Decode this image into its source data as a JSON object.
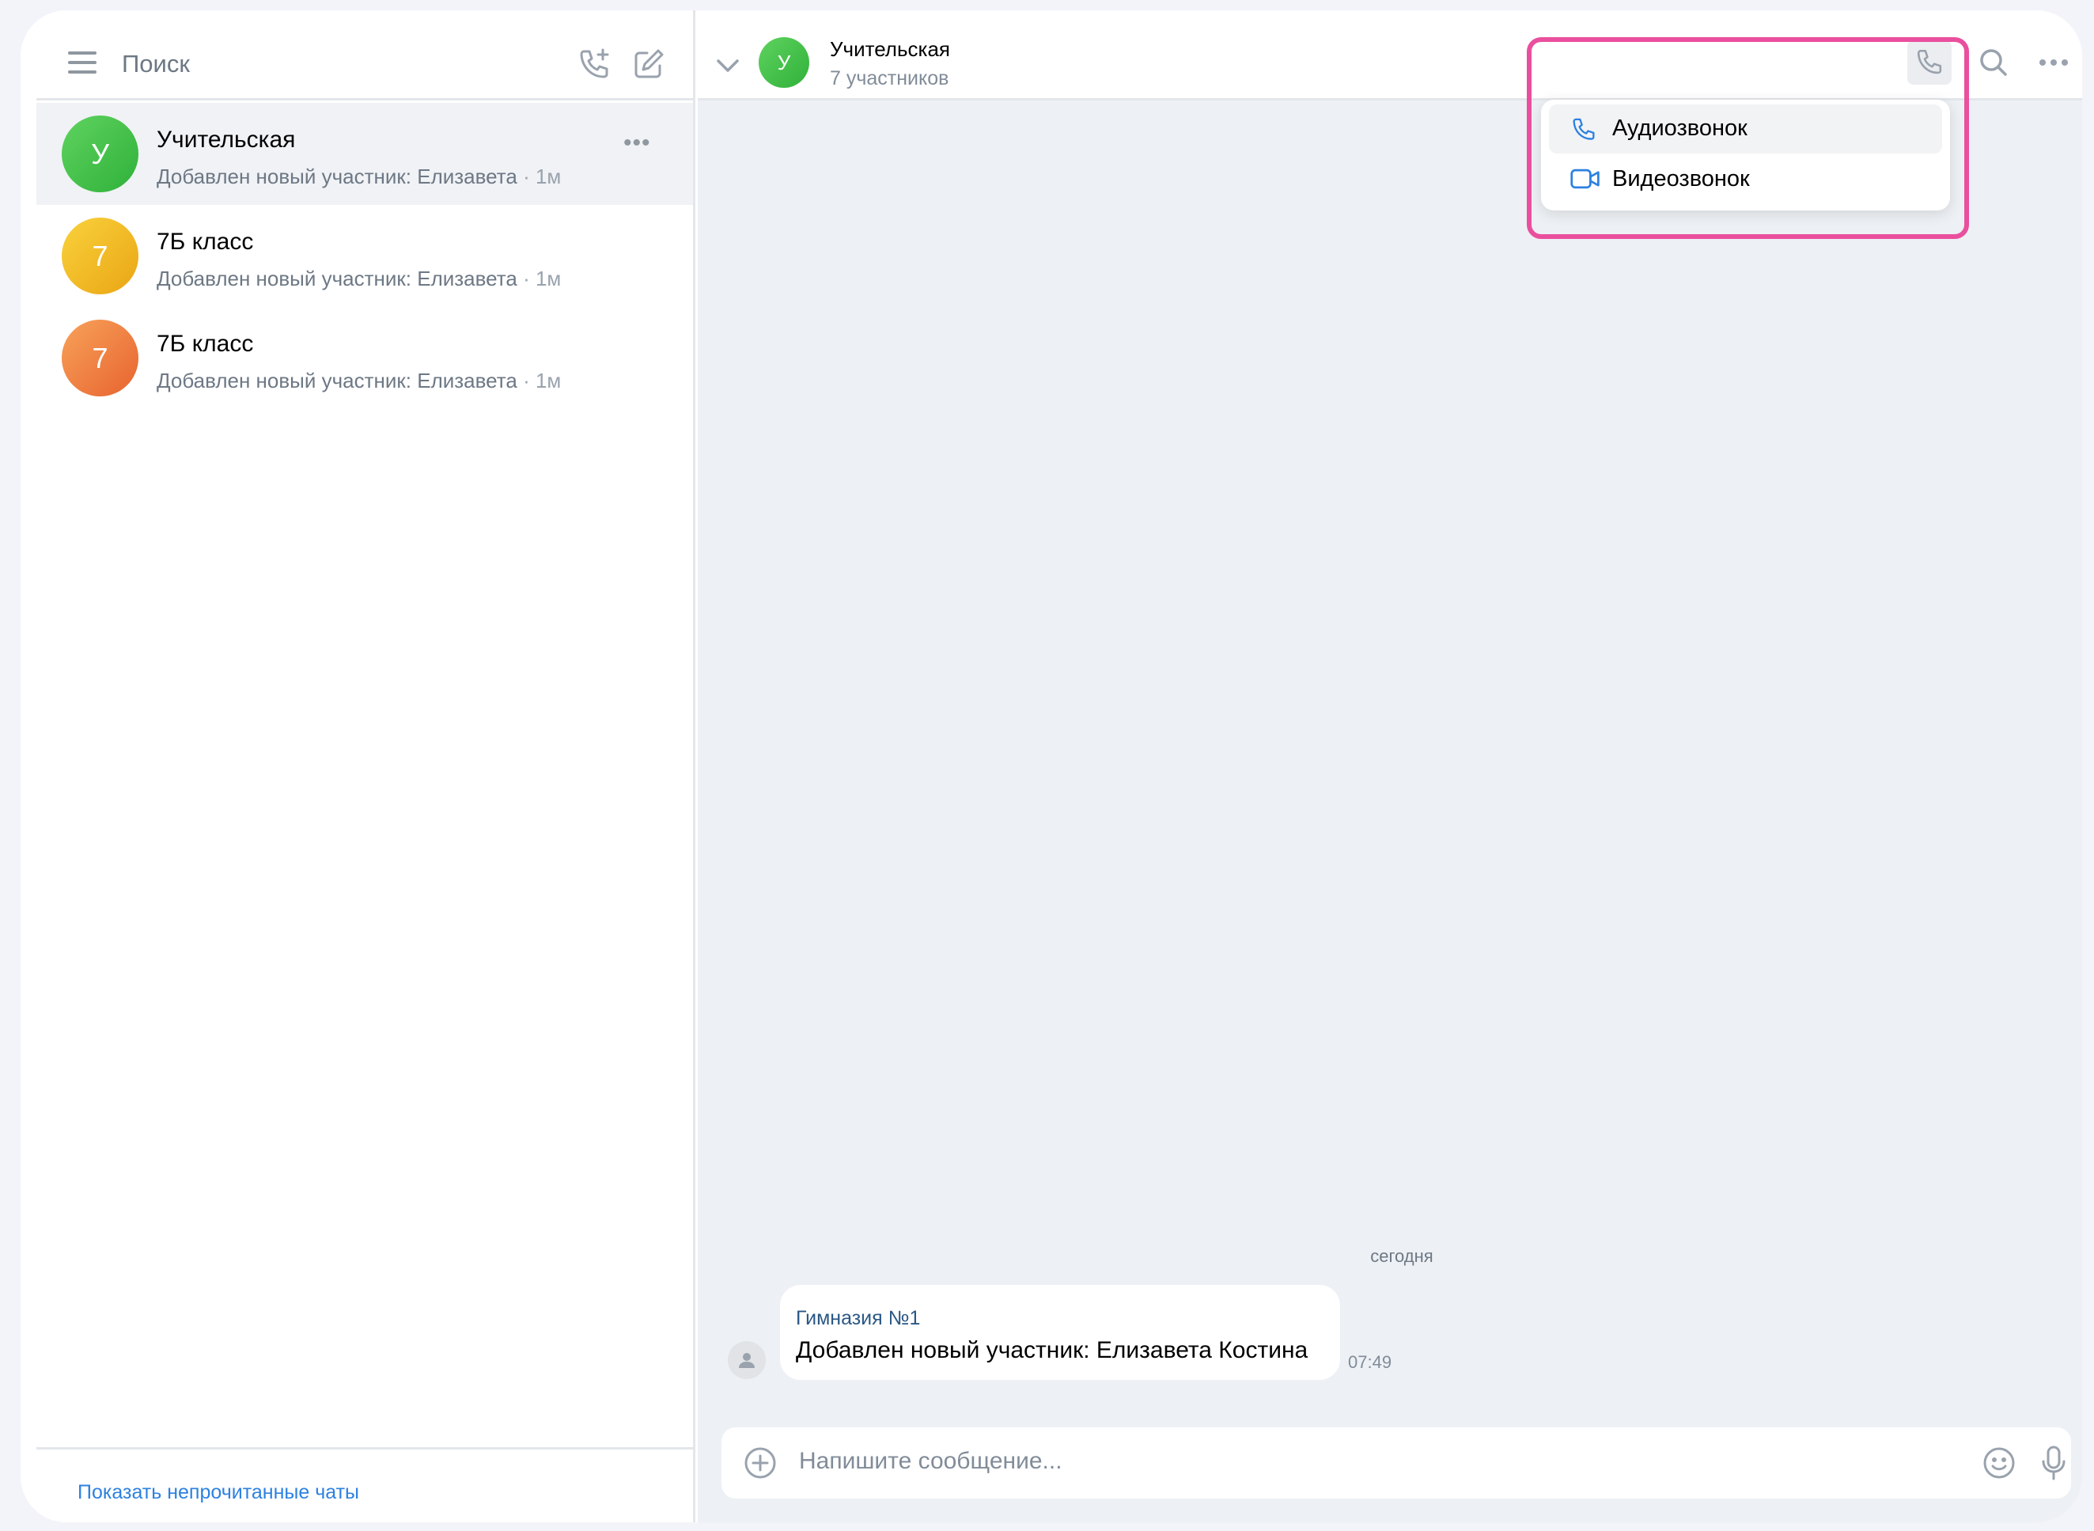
{
  "sidebar": {
    "search_label": "Поиск",
    "icons": [
      "menu-icon",
      "add-call-icon",
      "compose-icon"
    ],
    "chats": [
      {
        "title": "Учительская",
        "avatar_letter": "У",
        "avatar_color": "#3ec043",
        "preview": "Добавлен новый участник: Елизавета",
        "time": "· 1м",
        "active": true
      },
      {
        "title": "7Б класс",
        "avatar_letter": "7",
        "avatar_color": "#f3bc1f",
        "preview": "Добавлен новый участник: Елизавета",
        "time": "· 1м",
        "active": false
      },
      {
        "title": "7Б класс",
        "avatar_letter": "7",
        "avatar_color": "#ee7a3f",
        "preview": "Добавлен новый участник: Елизавета",
        "time": "· 1м",
        "active": false
      }
    ],
    "more_label": "•••",
    "footer_link": "Показать непрочитанные чаты"
  },
  "header": {
    "avatar_letter": "У",
    "title": "Учительская",
    "subtitle": "7 участников"
  },
  "call_menu": {
    "items": [
      {
        "label": "Аудиозвонок",
        "icon": "phone-icon"
      },
      {
        "label": "Видеозвонок",
        "icon": "video-icon"
      }
    ],
    "highlight_color": "#ea4f9e"
  },
  "messages": {
    "date_separator": "сегодня",
    "items": [
      {
        "sender": "Гимназия №1",
        "text": "Добавлен новый участник: Елизавета Костина",
        "time": "07:49"
      }
    ]
  },
  "composer": {
    "placeholder": "Напишите сообщение..."
  },
  "colors": {
    "accent": "#2d81e0",
    "icon": "#99a2ad"
  }
}
